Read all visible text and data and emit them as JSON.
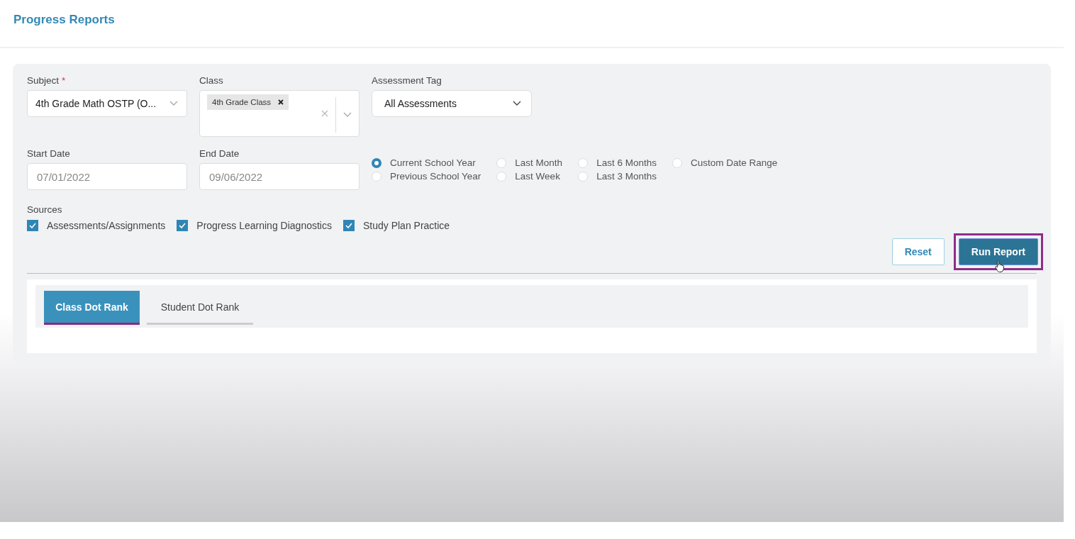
{
  "page": {
    "title": "Progress Reports"
  },
  "filters": {
    "subject": {
      "label": "Subject",
      "required_mark": "*",
      "value": "4th Grade Math OSTP (O..."
    },
    "class": {
      "label": "Class",
      "tags": [
        "4th Grade Class"
      ]
    },
    "assessment_tag": {
      "label": "Assessment Tag",
      "value": "All Assessments"
    },
    "start_date": {
      "label": "Start Date",
      "placeholder": "07/01/2022"
    },
    "end_date": {
      "label": "End Date",
      "placeholder": "09/06/2022"
    },
    "date_ranges": [
      {
        "label": "Current School Year",
        "selected": true
      },
      {
        "label": "Previous School Year",
        "selected": false
      },
      {
        "label": "Last Month",
        "selected": false
      },
      {
        "label": "Last Week",
        "selected": false
      },
      {
        "label": "Last 6 Months",
        "selected": false
      },
      {
        "label": "Last 3 Months",
        "selected": false
      },
      {
        "label": "Custom Date Range",
        "selected": false
      }
    ],
    "sources": {
      "label": "Sources",
      "items": [
        {
          "label": "Assessments/Assignments",
          "checked": true
        },
        {
          "label": "Progress Learning Diagnostics",
          "checked": true
        },
        {
          "label": "Study Plan Practice",
          "checked": true
        }
      ]
    }
  },
  "buttons": [
    {
      "label": "Reset",
      "kind": "secondary",
      "highlighted": false
    },
    {
      "label": "Run Report",
      "kind": "primary",
      "highlighted": true
    }
  ],
  "tabs": [
    {
      "label": "Class Dot Rank",
      "selected": true
    },
    {
      "label": "Student Dot Rank",
      "selected": false
    }
  ]
}
